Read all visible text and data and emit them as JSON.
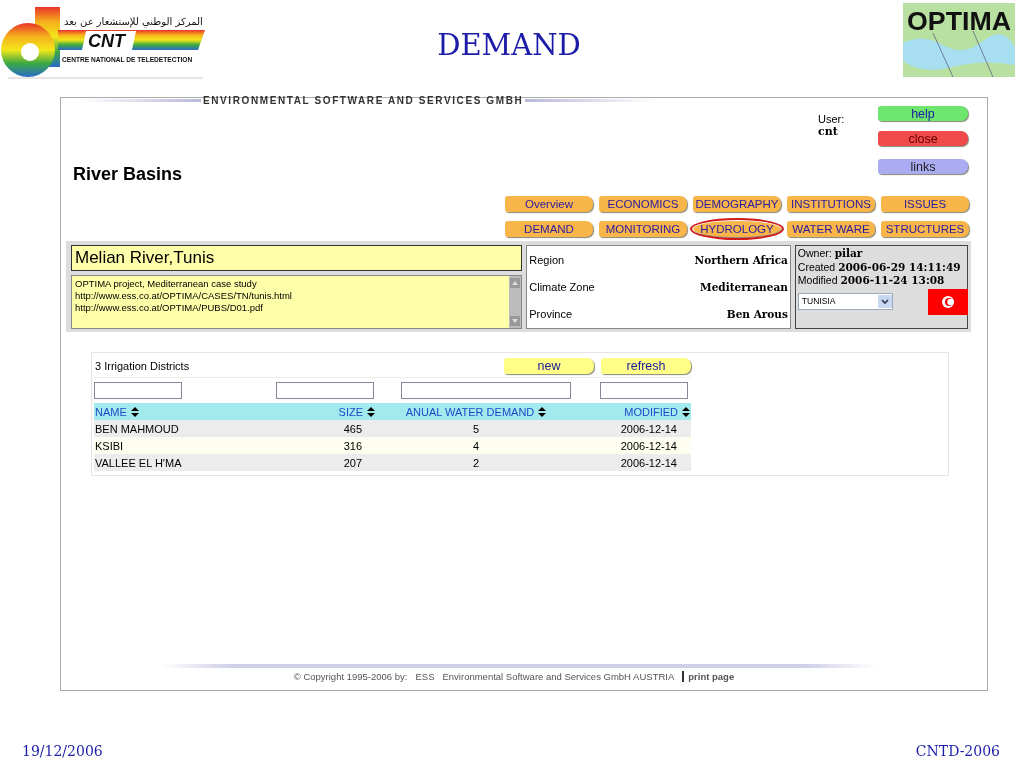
{
  "header": {
    "cnt_logo": {
      "arabic": "المركز الوطني للإستشعار عن بعد",
      "mark": "CNT",
      "subtitle": "CENTRE NATIONAL DE TELEDETECTION"
    },
    "title": "DEMAND",
    "optima_logo": {
      "text": "OPTIMA"
    }
  },
  "app": {
    "banner": "ENVIRONMENTAL SOFTWARE AND SERVICES GMBH",
    "user_label": "User:",
    "user": "cnt",
    "side_buttons": [
      {
        "label": "help",
        "color": "#6ee66e"
      },
      {
        "label": "close",
        "color": "#f04a4a"
      },
      {
        "label": "links",
        "color": "#ababf2"
      }
    ],
    "page_title": "River Basins",
    "nav": [
      {
        "label": "Overview",
        "circled": false
      },
      {
        "label": "ECONOMICS",
        "circled": false
      },
      {
        "label": "DEMOGRAPHY",
        "circled": false
      },
      {
        "label": "INSTITUTIONS",
        "circled": false
      },
      {
        "label": "ISSUES",
        "circled": false
      },
      {
        "label": "DEMAND",
        "circled": false
      },
      {
        "label": "MONITORING",
        "circled": false
      },
      {
        "label": "HYDROLOGY",
        "circled": true
      },
      {
        "label": "WATER WARE",
        "circled": false
      },
      {
        "label": "STRUCTURES",
        "circled": false
      }
    ],
    "basin": {
      "name": "Melian River,Tunis",
      "description": [
        "OPTIMA project, Mediterranean case study",
        "http://www.ess.co.at/OPTIMA/CASES/TN/tunis.html",
        "http://www.ess.co.at/OPTIMA/PUBS/D01.pdf"
      ],
      "properties": [
        {
          "label": "Region",
          "value": "Northern Africa"
        },
        {
          "label": "Climate Zone",
          "value": "Mediterranean"
        },
        {
          "label": "Province",
          "value": "Ben Arous"
        }
      ],
      "owner_label": "Owner:",
      "owner": "pilar",
      "created_label": "Created",
      "created": "2006-06-29 14:11:49",
      "modified_label": "Modified",
      "modified": "2006-11-24 13:08",
      "country": "TUNISIA"
    },
    "districts": {
      "count_title": "3 Irrigation Districts",
      "buttons": [
        "new",
        "refresh"
      ],
      "columns": [
        {
          "label": "NAME",
          "kind": "text"
        },
        {
          "label": "SIZE",
          "kind": "number"
        },
        {
          "label": "ANUAL WATER DEMAND",
          "kind": "count"
        },
        {
          "label": "MODIFIED",
          "kind": "date"
        }
      ],
      "rows": [
        [
          "BEN MAHMOUD",
          "465",
          "5",
          "2006-12-14"
        ],
        [
          "KSIBI",
          "316",
          "4",
          "2006-12-14"
        ],
        [
          "VALLEE EL H'MA",
          "207",
          "2",
          "2006-12-14"
        ]
      ]
    },
    "footer": {
      "copyright": "© Copyright 1995-2006 by:",
      "company": "ESS",
      "company_name": "Environmental Software and Services GmbH AUSTRIA",
      "print_link": "print page"
    }
  },
  "slide_footer": {
    "date": "19/12/2006",
    "code": "CNTD-2006"
  }
}
